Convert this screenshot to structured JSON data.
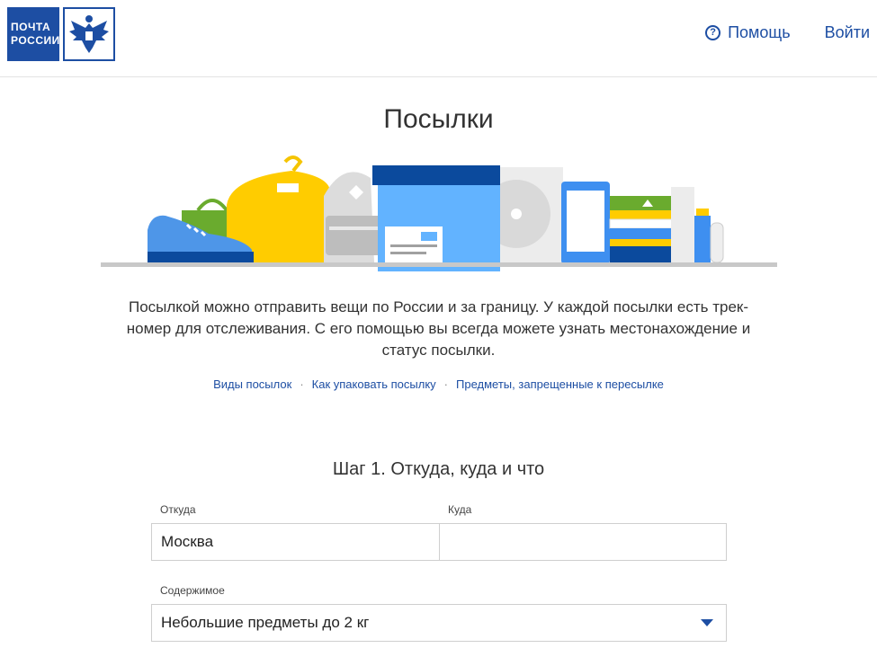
{
  "header": {
    "logo_line1": "ПОЧТА",
    "logo_line2": "РОССИИ",
    "help_label": "Помощь",
    "help_glyph": "?",
    "login_label": "Войти"
  },
  "page": {
    "title": "Посылки",
    "description": "Посылкой можно отправить вещи по России и за границу. У каждой посылки есть трек-номер для отслеживания. С его помощью вы всегда можете узнать местонахождение и статус посылки.",
    "links": [
      "Виды посылок",
      "Как упаковать посылку",
      "Предметы, запрещенные к пересылке"
    ],
    "link_separator": "·"
  },
  "form": {
    "step_title": "Шаг 1. Откуда, куда и что",
    "from_label": "Откуда",
    "from_value": "Москва",
    "to_label": "Куда",
    "to_value": "",
    "content_label": "Содержимое",
    "content_value": "Небольшие предметы до 2 кг"
  },
  "colors": {
    "brand_blue": "#1d4ea3",
    "border": "#cfcfcf"
  }
}
